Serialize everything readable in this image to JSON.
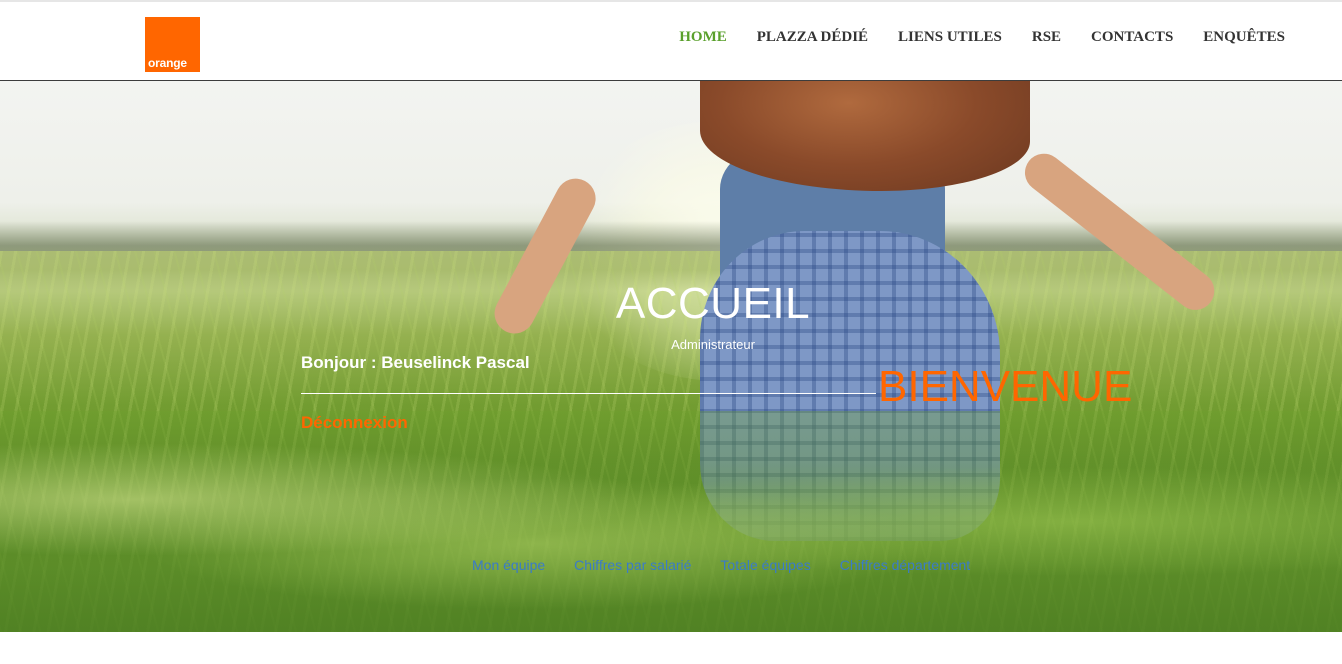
{
  "header": {
    "logo_text": "orange",
    "nav": [
      {
        "label": "HOME",
        "active": true
      },
      {
        "label": "PLAZZA DÉDIÉ",
        "active": false
      },
      {
        "label": "LIENS UTILES",
        "active": false
      },
      {
        "label": "RSE",
        "active": false
      },
      {
        "label": "CONTACTS",
        "active": false
      },
      {
        "label": "ENQUÊTES",
        "active": false
      }
    ]
  },
  "hero": {
    "title": "ACCUEIL",
    "role": "Administrateur",
    "greeting": "Bonjour : Beuselinck Pascal",
    "welcome": "BIENVENUE",
    "logout": "Déconnexion",
    "links": [
      "Mon équipe",
      "Chiffres par salarié",
      "Totale équipes",
      "Chiffres département"
    ]
  },
  "colors": {
    "brand_orange": "#ff6600",
    "nav_active": "#5aa02c",
    "link_blue": "#3a7bc8"
  }
}
